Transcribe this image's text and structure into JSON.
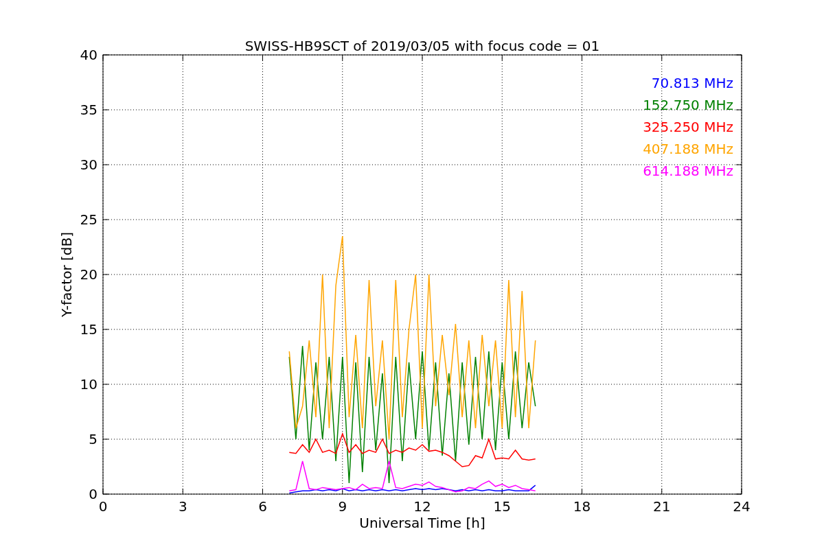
{
  "chart_data": {
    "type": "line",
    "title": "SWISS-HB9SCT of 2019/03/05 with focus code = 01",
    "xlabel": "Universal Time [h]",
    "ylabel": "Y-factor [dB]",
    "xlim": [
      0,
      24
    ],
    "ylim": [
      0,
      40
    ],
    "xticks": [
      0,
      3,
      6,
      9,
      12,
      15,
      18,
      21,
      24
    ],
    "yticks": [
      0,
      5,
      10,
      15,
      20,
      25,
      30,
      35,
      40
    ],
    "grid": true,
    "x": [
      7,
      7.25,
      7.5,
      7.75,
      8,
      8.25,
      8.5,
      8.75,
      9,
      9.25,
      9.5,
      9.75,
      10,
      10.25,
      10.5,
      10.75,
      11,
      11.25,
      11.5,
      11.75,
      12,
      12.25,
      12.5,
      12.75,
      13,
      13.25,
      13.5,
      13.75,
      14,
      14.25,
      14.5,
      14.75,
      15,
      15.25,
      15.5,
      15.75,
      16,
      16.25
    ],
    "series": [
      {
        "name": "70.813 MHz",
        "color": "#0000ff",
        "values": [
          0.1,
          0.2,
          0.3,
          0.3,
          0.4,
          0.3,
          0.4,
          0.3,
          0.5,
          0.3,
          0.4,
          0.3,
          0.4,
          0.3,
          0.4,
          0.3,
          0.4,
          0.3,
          0.4,
          0.5,
          0.4,
          0.5,
          0.4,
          0.5,
          0.4,
          0.3,
          0.4,
          0.3,
          0.4,
          0.3,
          0.4,
          0.3,
          0.3,
          0.4,
          0.3,
          0.3,
          0.3,
          0.8
        ]
      },
      {
        "name": "152.750 MHz",
        "color": "#008000",
        "values": [
          12.5,
          5,
          13.5,
          4,
          12,
          5,
          12.5,
          3,
          12.5,
          1,
          12,
          2,
          12.5,
          4,
          11,
          1,
          12.5,
          3,
          12,
          5,
          13,
          4,
          12,
          3.5,
          11,
          3,
          12,
          4.5,
          12.5,
          5,
          13,
          4,
          12,
          5,
          13,
          6,
          12,
          8
        ]
      },
      {
        "name": "325.250 MHz",
        "color": "#ff0000",
        "values": [
          3.8,
          3.7,
          4.5,
          3.8,
          5,
          3.8,
          4,
          3.7,
          5.5,
          3.8,
          4.5,
          3.7,
          4,
          3.8,
          5,
          3.7,
          4,
          3.8,
          4.2,
          4,
          4.5,
          3.9,
          4,
          3.8,
          3.5,
          3,
          2.5,
          2.6,
          3.5,
          3.3,
          5,
          3.2,
          3.3,
          3.2,
          4,
          3.2,
          3.1,
          3.2
        ]
      },
      {
        "name": "407.188 MHz",
        "color": "#ffa500",
        "values": [
          13,
          6,
          8,
          14,
          7,
          20,
          6,
          19,
          23.5,
          7,
          14.5,
          6,
          19.5,
          8,
          14,
          5,
          19.5,
          7,
          15,
          20,
          6,
          20,
          8,
          14.5,
          9,
          15.5,
          7,
          14,
          6,
          14.5,
          8,
          14,
          6,
          19.5,
          7,
          18.5,
          6,
          14
        ]
      },
      {
        "name": "614.188 MHz",
        "color": "#ff00ff",
        "values": [
          0.3,
          0.4,
          3,
          0.5,
          0.4,
          0.6,
          0.5,
          0.4,
          0.5,
          0.6,
          0.4,
          0.9,
          0.5,
          0.6,
          0.5,
          3,
          0.6,
          0.5,
          0.7,
          0.9,
          0.8,
          1.1,
          0.7,
          0.6,
          0.4,
          0.2,
          0.3,
          0.6,
          0.5,
          0.9,
          1.2,
          0.7,
          0.9,
          0.6,
          0.8,
          0.5,
          0.4,
          0.3
        ]
      }
    ]
  }
}
